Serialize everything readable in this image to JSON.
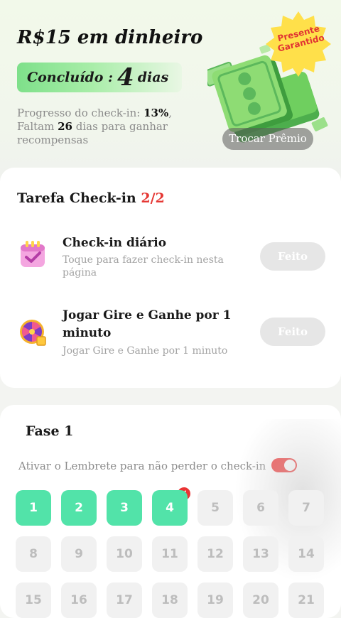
{
  "header": {
    "reward_title": "R$15 em dinheiro",
    "done_label": "Concluído :",
    "done_days": "4",
    "done_unit": "dias",
    "progress_prefix": "Progresso do check-in:",
    "progress_percent": "13%",
    "progress_suffix": ",",
    "remaining_prefix": "Faltam",
    "remaining_days": "26",
    "remaining_suffix": "dias para ganhar recompensas",
    "badge_line1": "Presente",
    "badge_line2": "Garantido",
    "swap_button": "Trocar Prêmio"
  },
  "tasks": {
    "title": "Tarefa Check-in",
    "count": "2/2",
    "items": [
      {
        "name": "Check-in diário",
        "desc": "Toque para fazer check-in nesta página",
        "button": "Feito",
        "icon": "calendar-icon"
      },
      {
        "name": "Jogar Gire e Ganhe por 1 minuto",
        "desc": "Jogar Gire e Ganhe por 1 minuto",
        "button": "Feito",
        "icon": "prize-wheel-icon"
      }
    ]
  },
  "phase": {
    "title": "Fase 1",
    "reminder_label": "Ativar o Lembrete para não perder o check-in",
    "reminder_on": true,
    "checked_days": 4,
    "days": [
      "1",
      "2",
      "3",
      "4",
      "5",
      "6",
      "7",
      "8",
      "9",
      "10",
      "11",
      "12",
      "13",
      "14",
      "15",
      "16",
      "17",
      "18",
      "19",
      "20",
      "21"
    ]
  },
  "colors": {
    "accent_green": "#52e3a9",
    "toggle_red": "#ef3b3b",
    "highlight_red": "#e53935"
  }
}
